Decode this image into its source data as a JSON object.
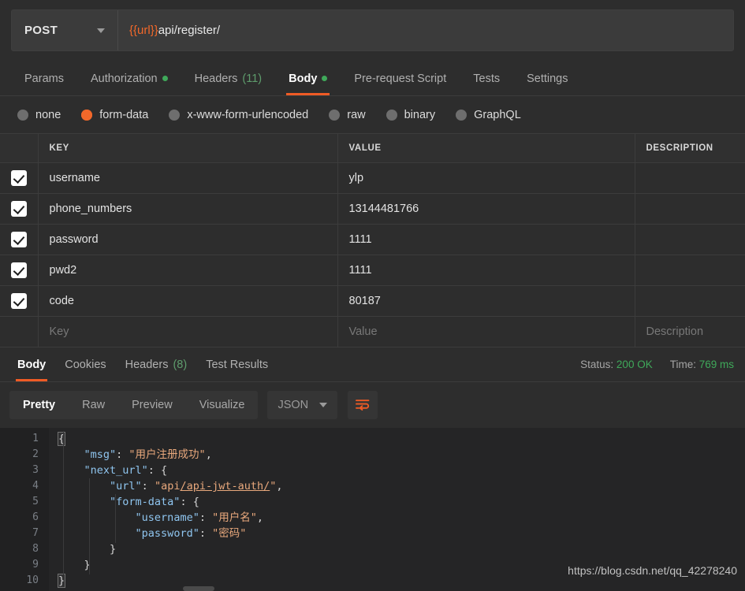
{
  "request": {
    "method": "POST",
    "url_variable": "{{url}}",
    "url_path": "api/register/",
    "url_full": "{{url}}api/register/"
  },
  "request_tabs": [
    {
      "label": "Params",
      "badge": "",
      "dot": false,
      "active": false
    },
    {
      "label": "Authorization",
      "badge": "",
      "dot": true,
      "active": false
    },
    {
      "label": "Headers",
      "badge": "(11)",
      "dot": false,
      "active": false
    },
    {
      "label": "Body",
      "badge": "",
      "dot": true,
      "active": true
    },
    {
      "label": "Pre-request Script",
      "badge": "",
      "dot": false,
      "active": false
    },
    {
      "label": "Tests",
      "badge": "",
      "dot": false,
      "active": false
    },
    {
      "label": "Settings",
      "badge": "",
      "dot": false,
      "active": false
    }
  ],
  "body_types": [
    {
      "label": "none",
      "selected": false
    },
    {
      "label": "form-data",
      "selected": true
    },
    {
      "label": "x-www-form-urlencoded",
      "selected": false
    },
    {
      "label": "raw",
      "selected": false
    },
    {
      "label": "binary",
      "selected": false
    },
    {
      "label": "GraphQL",
      "selected": false
    }
  ],
  "form_table": {
    "headers": [
      "KEY",
      "VALUE",
      "DESCRIPTION"
    ],
    "rows": [
      {
        "checked": true,
        "key": "username",
        "value": "ylp",
        "description": ""
      },
      {
        "checked": true,
        "key": "phone_numbers",
        "value": "13144481766",
        "description": ""
      },
      {
        "checked": true,
        "key": "password",
        "value": "1111",
        "description": ""
      },
      {
        "checked": true,
        "key": "pwd2",
        "value": "1111",
        "description": ""
      },
      {
        "checked": true,
        "key": "code",
        "value": "80187",
        "description": ""
      }
    ],
    "placeholder_row": {
      "key": "Key",
      "value": "Value",
      "description": "Description"
    }
  },
  "response_tabs": [
    {
      "label": "Body",
      "badge": "",
      "active": true
    },
    {
      "label": "Cookies",
      "badge": "",
      "active": false
    },
    {
      "label": "Headers",
      "badge": "(8)",
      "active": false
    },
    {
      "label": "Test Results",
      "badge": "",
      "active": false
    }
  ],
  "response_meta": {
    "status_label": "Status:",
    "status_value": "200 OK",
    "time_label": "Time:",
    "time_value": "769 ms"
  },
  "viewer": {
    "modes": [
      {
        "label": "Pretty",
        "active": true
      },
      {
        "label": "Raw",
        "active": false
      },
      {
        "label": "Preview",
        "active": false
      },
      {
        "label": "Visualize",
        "active": false
      }
    ],
    "format": "JSON",
    "wrap_icon": "word-wrap-icon"
  },
  "response_body": {
    "line_numbers": [
      "1",
      "2",
      "3",
      "4",
      "5",
      "6",
      "7",
      "8",
      "9",
      "10"
    ],
    "lines": [
      {
        "n": 1,
        "indent": 0,
        "segments": [
          {
            "t": "punct",
            "v": "{"
          }
        ]
      },
      {
        "n": 2,
        "indent": 1,
        "segments": [
          {
            "t": "key",
            "v": "\"msg\""
          },
          {
            "t": "punct",
            "v": ": "
          },
          {
            "t": "str",
            "v": "\"用户注册成功\""
          },
          {
            "t": "punct",
            "v": ","
          }
        ]
      },
      {
        "n": 3,
        "indent": 1,
        "segments": [
          {
            "t": "key",
            "v": "\"next_url\""
          },
          {
            "t": "punct",
            "v": ": {"
          }
        ]
      },
      {
        "n": 4,
        "indent": 2,
        "segments": [
          {
            "t": "key",
            "v": "\"url\""
          },
          {
            "t": "punct",
            "v": ": "
          },
          {
            "t": "str",
            "v": "\"api"
          },
          {
            "t": "link",
            "v": "/api-jwt-auth/"
          },
          {
            "t": "str",
            "v": "\""
          },
          {
            "t": "punct",
            "v": ","
          }
        ]
      },
      {
        "n": 5,
        "indent": 2,
        "segments": [
          {
            "t": "key",
            "v": "\"form-data\""
          },
          {
            "t": "punct",
            "v": ": {"
          }
        ]
      },
      {
        "n": 6,
        "indent": 3,
        "segments": [
          {
            "t": "key",
            "v": "\"username\""
          },
          {
            "t": "punct",
            "v": ": "
          },
          {
            "t": "str",
            "v": "\"用户名\""
          },
          {
            "t": "punct",
            "v": ","
          }
        ]
      },
      {
        "n": 7,
        "indent": 3,
        "segments": [
          {
            "t": "key",
            "v": "\"password\""
          },
          {
            "t": "punct",
            "v": ": "
          },
          {
            "t": "str",
            "v": "\"密码\""
          }
        ]
      },
      {
        "n": 8,
        "indent": 2,
        "segments": [
          {
            "t": "punct",
            "v": "}"
          }
        ]
      },
      {
        "n": 9,
        "indent": 1,
        "segments": [
          {
            "t": "punct",
            "v": "}"
          }
        ]
      },
      {
        "n": 10,
        "indent": 0,
        "segments": [
          {
            "t": "punct",
            "v": "}"
          }
        ]
      }
    ],
    "raw_text": "{\n    \"msg\": \"用户注册成功\",\n    \"next_url\": {\n        \"url\": \"api/api-jwt-auth/\",\n        \"form-data\": {\n            \"username\": \"用户名\",\n            \"password\": \"密码\"\n        }\n    }\n}"
  },
  "watermark": "https://blog.csdn.net/qq_42278240",
  "colors": {
    "accent_orange": "#ef5b25",
    "var_orange": "#f2682a",
    "success_green": "#3fa95a",
    "bg_panel": "#2d2d2d",
    "bg_code": "#252526",
    "json_key": "#8fc5ef",
    "json_string": "#e8a87c"
  }
}
